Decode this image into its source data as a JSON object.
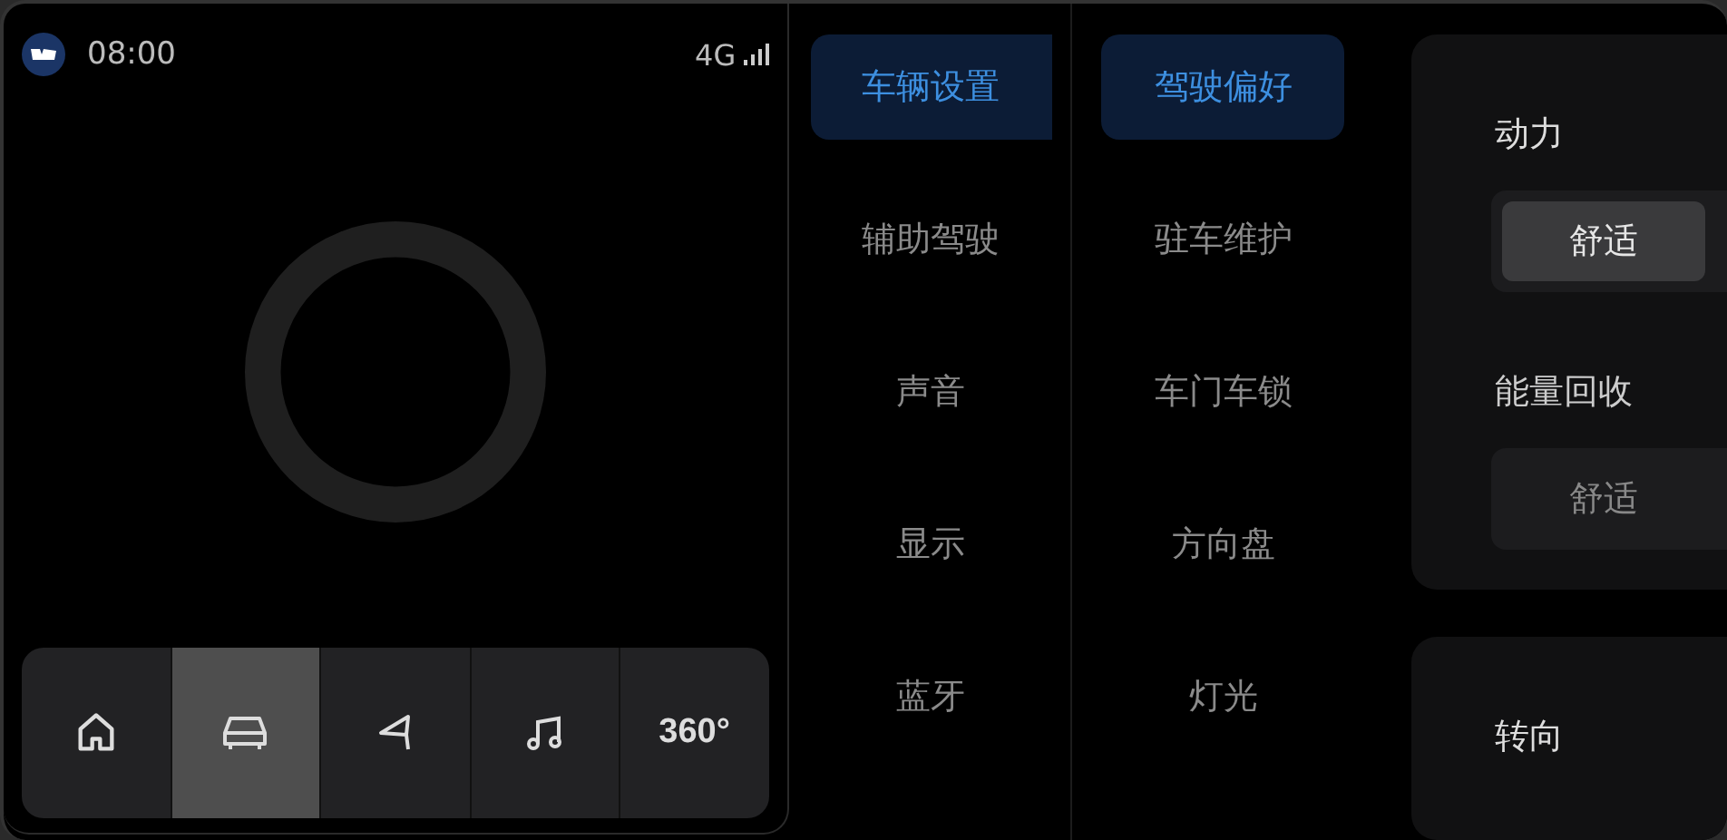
{
  "status_bar": {
    "time": "08:00",
    "network": "4G"
  },
  "dock": [
    {
      "kind": "home",
      "selected": false
    },
    {
      "kind": "car",
      "selected": true
    },
    {
      "kind": "navigation",
      "selected": false
    },
    {
      "kind": "music",
      "selected": false
    },
    {
      "kind": "text",
      "label": "360°",
      "selected": false
    }
  ],
  "categories": [
    {
      "label": "车辆设置",
      "selected": true
    },
    {
      "label": "辅助驾驶",
      "selected": false
    },
    {
      "label": "声音",
      "selected": false
    },
    {
      "label": "显示",
      "selected": false
    },
    {
      "label": "蓝牙",
      "selected": false
    }
  ],
  "subcategories": [
    {
      "label": "驾驶偏好",
      "selected": true
    },
    {
      "label": "驻车维护",
      "selected": false
    },
    {
      "label": "车门车锁",
      "selected": false
    },
    {
      "label": "方向盘",
      "selected": false
    },
    {
      "label": "灯光",
      "selected": false
    }
  ],
  "settings": [
    {
      "title": "动力",
      "options": [
        {
          "label": "舒适",
          "selected": true
        }
      ],
      "enabled": true
    },
    {
      "title": "能量回收",
      "options": [
        {
          "label": "舒适",
          "selected": false
        }
      ],
      "enabled": false
    }
  ],
  "next_section": {
    "title": "转向"
  }
}
